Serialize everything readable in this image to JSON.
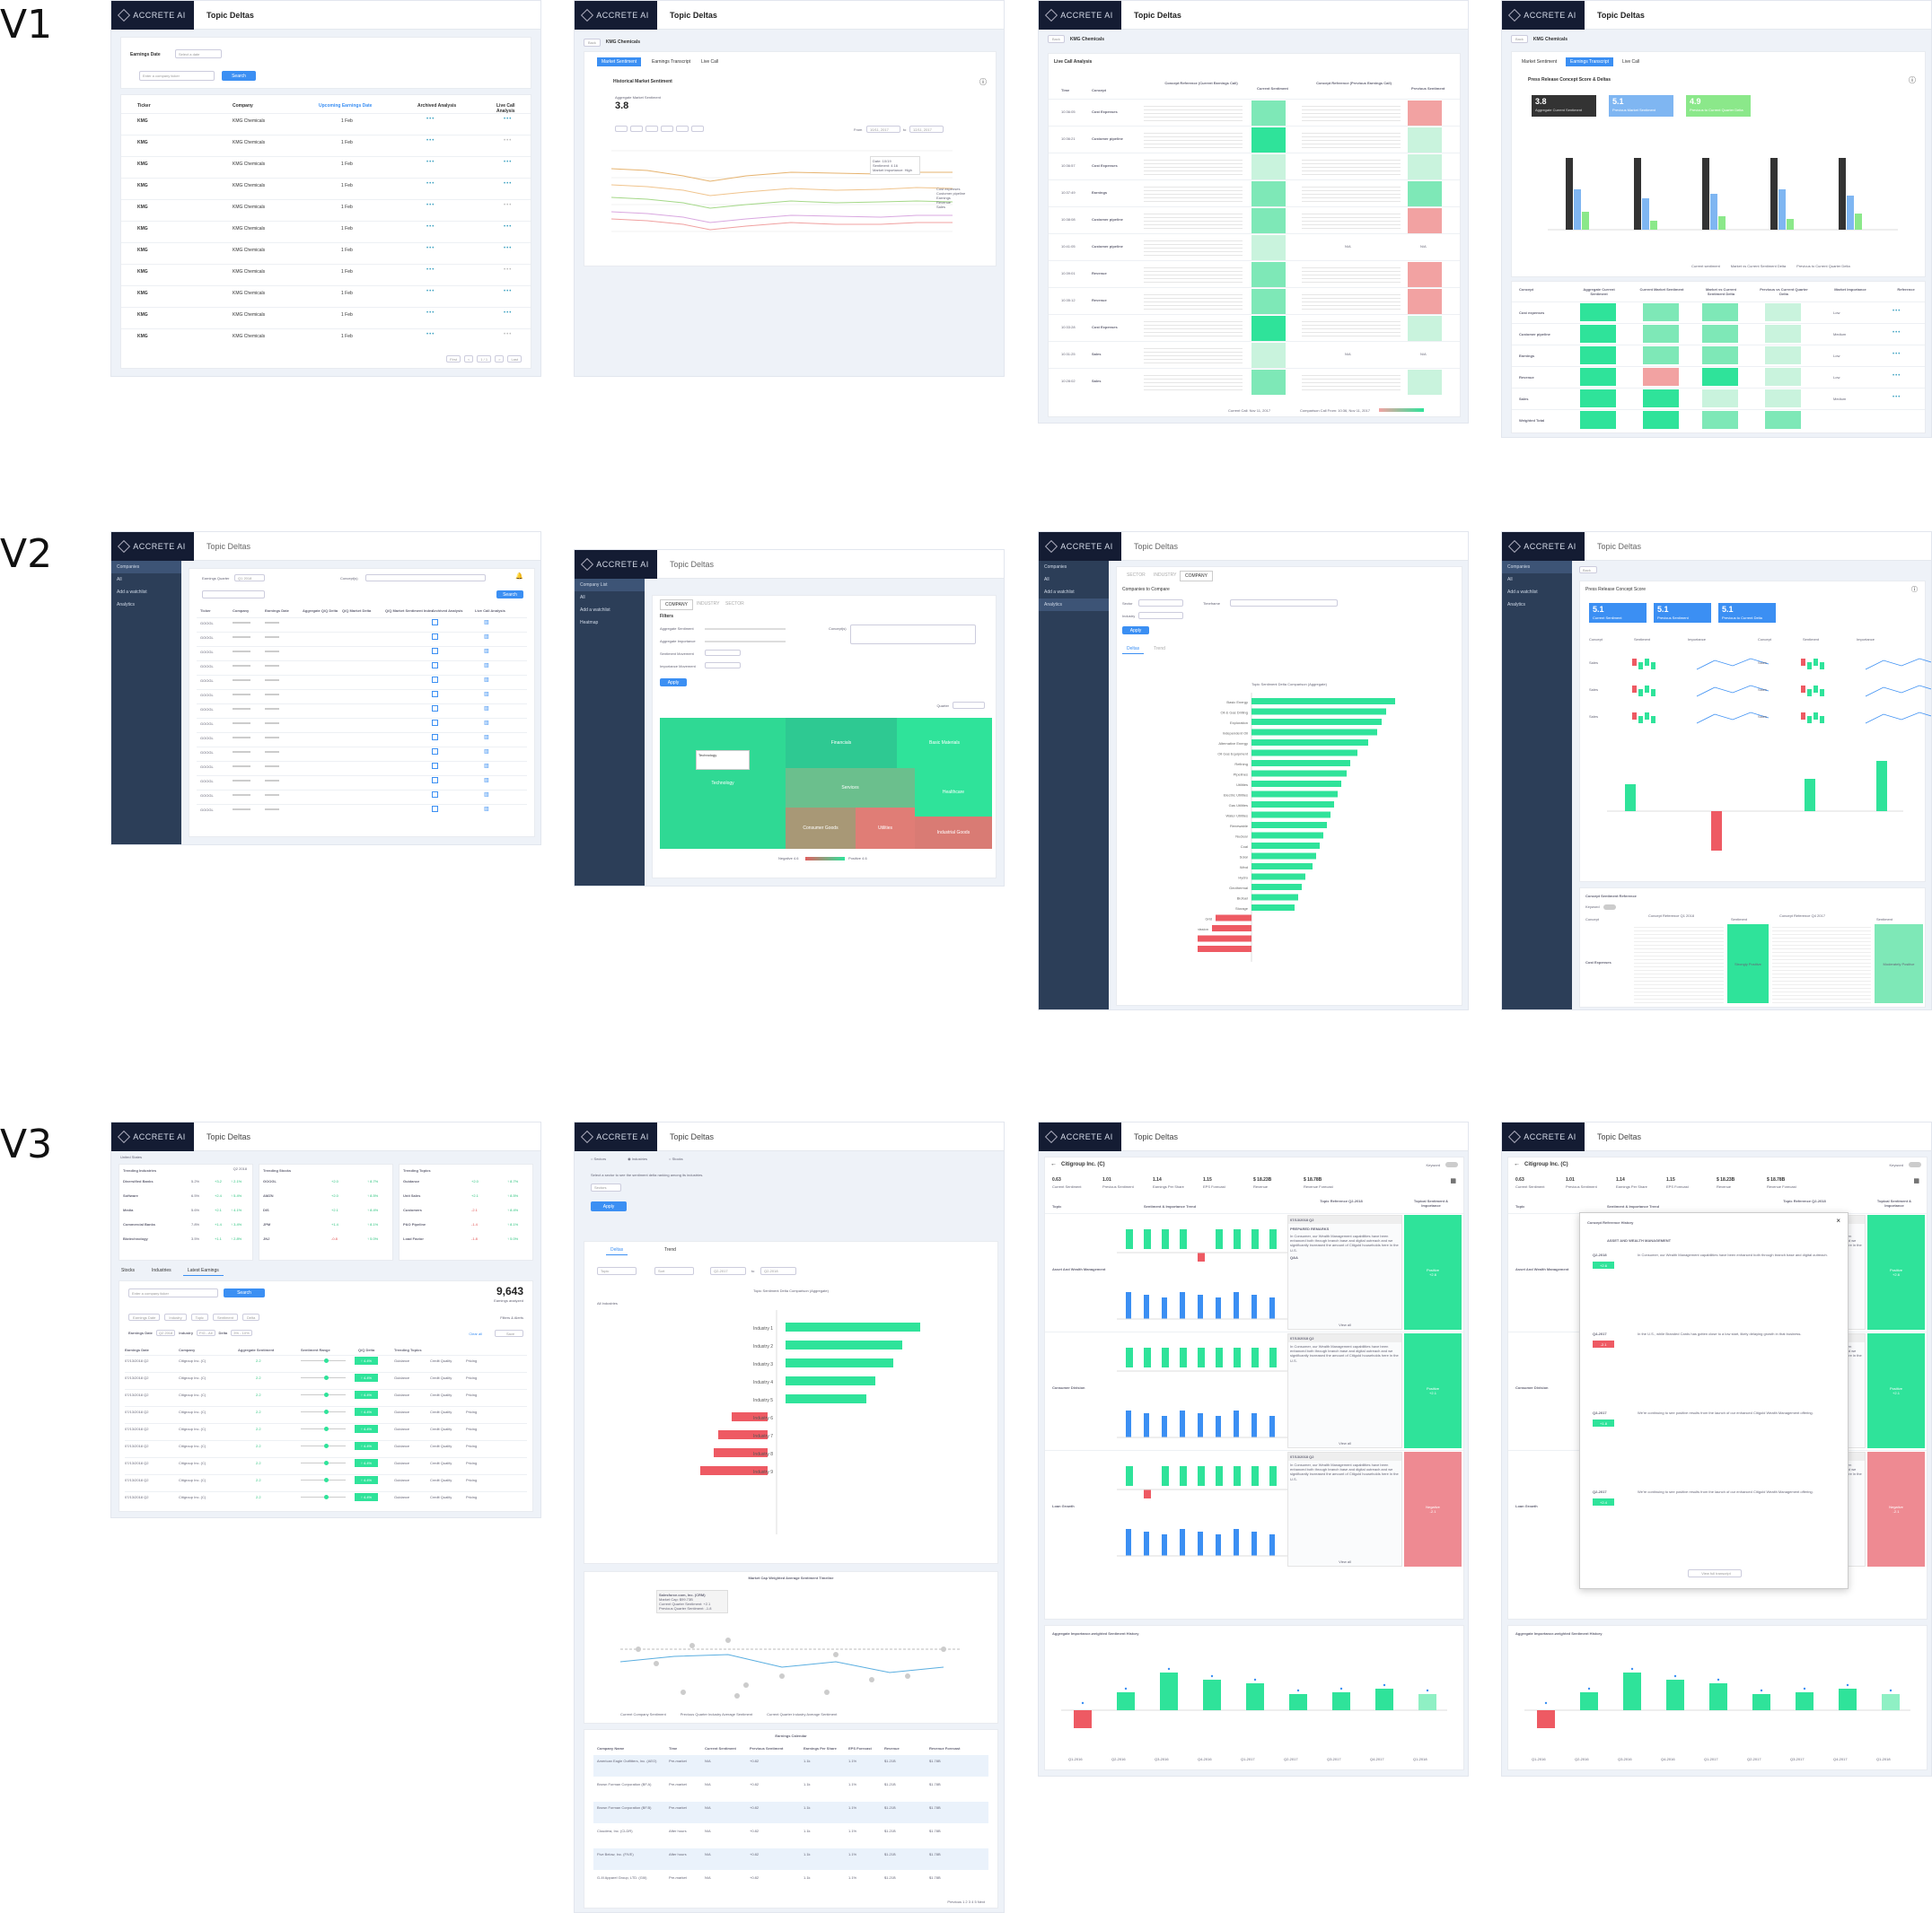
{
  "rows": {
    "v1": "V1",
    "v2": "V2",
    "v3": "V3"
  },
  "app": {
    "logo": "ACCRETE AI",
    "title": "Topic Deltas"
  },
  "v1a": {
    "label": "Earnings Date",
    "select": "Select a date",
    "search_placeholder": "Enter a company ticker",
    "search_btn": "Search",
    "cols": [
      "Ticker",
      "Company",
      "Upcoming Earnings Date",
      "Archived Analysis",
      "Live Call Analysis"
    ],
    "ticker": "KMG",
    "company": "KMG Chemicals",
    "date": "1 Feb",
    "pager": [
      "First",
      "<",
      "1 / 1",
      ">",
      "Last"
    ]
  },
  "v1b": {
    "back": "Back",
    "company": "KMG Chemicals",
    "tabs": [
      "Market Sentiment",
      "Earnings Transcript",
      "Live Call"
    ],
    "chart_title": "Historical Market Sentiment",
    "agg_label": "Aggregate Market Sentiment",
    "agg_value": "3.8",
    "from": "From",
    "to": "to",
    "from_date": "10/11, 2017",
    "to_date": "12/11, 2017",
    "legend": [
      "Cost expenses",
      "Customer pipeline",
      "Earnings",
      "Revenue",
      "Sales"
    ],
    "tooltip": [
      "Date: 10/19",
      "Sentiment: 4.16",
      "Market Importance: High"
    ]
  },
  "v1c": {
    "back": "Back",
    "company": "KMG Chemicals",
    "section": "Live Call Analysis",
    "cols": [
      "Time",
      "Concept",
      "Concept Reference (Current Earnings Call)",
      "Current Sentiment",
      "Concept Reference (Previous Earnings Call)",
      "Previous Sentiment"
    ],
    "rows": [
      [
        "10:36:05",
        "Cost Expenses"
      ],
      [
        "10:36:21",
        "Customer pipeline"
      ],
      [
        "10:36:57",
        "Cost Expenses"
      ],
      [
        "10:37:49",
        "Earnings"
      ],
      [
        "10:38:08",
        "Customer pipeline"
      ],
      [
        "10:41:05",
        "Customer pipeline"
      ],
      [
        "10:39:01",
        "Revenue"
      ],
      [
        "10:35:12",
        "Revenue"
      ],
      [
        "10:33:28",
        "Cost Expenses"
      ],
      [
        "10:31:25",
        "Sales"
      ],
      [
        "10:28:02",
        "Sales"
      ]
    ],
    "na": "N/A",
    "footer": [
      "Current Call: Nov 11, 2017",
      "Comparison Call From: 10:36, Nov 11, 2017"
    ]
  },
  "v1d": {
    "back": "Back",
    "company": "KMG Chemicals",
    "tabs": [
      "Market Sentiment",
      "Earnings Transcript",
      "Live Call"
    ],
    "chart_title": "Press Release Concept Score & Deltas",
    "kpis": [
      {
        "value": "3.8",
        "label": "Aggregate Current Sentiment"
      },
      {
        "value": "5.1",
        "label": "Previous Market Sentiment"
      },
      {
        "value": "4.9",
        "label": "Previous to Current Quarter Delta"
      }
    ],
    "legend": [
      "Current sentiment",
      "Market vs Current Sentiment Delta",
      "Previous to Current Quarter Delta"
    ],
    "cols": [
      "Concept",
      "Aggregate Current Sentiment",
      "Current Market Sentiment",
      "Market vs Current Sentiment Delta",
      "Previous vs Current Quarter Delta",
      "Market Importance",
      "Reference"
    ],
    "rows": [
      [
        "Cost expenses",
        "Low"
      ],
      [
        "Customer pipeline",
        "Medium"
      ],
      [
        "Earnings",
        "Low"
      ],
      [
        "Revenue",
        "Low"
      ],
      [
        "Sales",
        "Medium"
      ],
      [
        "Weighted Total",
        ""
      ]
    ]
  },
  "v2a": {
    "side": [
      "Companies",
      "All",
      "Add a watchlist",
      "Analytics"
    ],
    "quarter_label": "Earnings Quarter",
    "quarter": "Q1 2018",
    "concept_label": "Concept(s)",
    "search_btn": "Search",
    "cols": [
      "Ticker",
      "Company",
      "Earnings Date",
      "Aggregate Q/Q Delta",
      "Q/Q Market Delta",
      "Q/Q Market Sentiment Index",
      "Archived Analysis",
      "Live Call Analysis"
    ],
    "ticker": "GOOGL"
  },
  "v2b": {
    "side": [
      "Company List",
      "All",
      "Add a watchlist",
      "Heatmap"
    ],
    "tabs": [
      "COMPANY",
      "INDUSTRY",
      "SECTOR"
    ],
    "filters_title": "Filters",
    "filters": [
      "Aggregate Sentiment",
      "Aggregate Importance",
      "Sentiment Movement",
      "Importance Movement"
    ],
    "concepts_label": "Concept(s)",
    "apply": "Apply",
    "quarter_label": "Quarter",
    "tiles": [
      "Technology",
      "Financials",
      "Basic Materials",
      "Services",
      "Healthcare",
      "Consumer Goods",
      "Utilities",
      "Industrial Goods"
    ],
    "tooltip": "Technology",
    "neg": "Negative 4.6",
    "pos": "Positive 4.6"
  },
  "v2c": {
    "tabs": [
      "SECTOR",
      "INDUSTRY",
      "COMPANY"
    ],
    "compare_label": "Companies to Compare",
    "sector_label": "Sector",
    "industry_label": "Industry",
    "timeframe_label": "Timeframe",
    "apply": "Apply",
    "subtabs": [
      "Deltas",
      "Trend"
    ],
    "chart_title": "Topic Sentiment Delta Comparison (Aggregate)",
    "bars": [
      "Basic Energy",
      "Oil & Gas Drilling",
      "Exploration",
      "Independent Oil",
      "Alternative Energy",
      "Oil Gas Equipment",
      "Refining",
      "Pipelines",
      "Utilities",
      "Electric Utilities",
      "Gas Utilities",
      "Water Utilities",
      "Renewable",
      "Nuclear",
      "Coal",
      "Solar",
      "Wind",
      "Hydro",
      "Geothermal",
      "Biofuel",
      "Storage",
      "Grid",
      "Transmission",
      "Distribution",
      "Retail Energy"
    ]
  },
  "v2d": {
    "back": "Back",
    "chart_title": "Press Release Concept Score",
    "kpis": [
      {
        "value": "5.1",
        "label": "Current Sentiment"
      },
      {
        "value": "5.1",
        "label": "Previous Sentiment"
      },
      {
        "value": "5.1",
        "label": "Previous to Current Delta"
      }
    ],
    "cols": [
      "Concept",
      "Sentiment",
      "Importance"
    ],
    "concepts": [
      "Sales",
      "Sales",
      "Sales"
    ],
    "ref_title": "Concept Sentiment Reference",
    "keyword": "Keyword",
    "ref_cols": [
      "Concept",
      "Concept Reference Q1 2018",
      "Sentiment",
      "Concept Reference Q4 2017",
      "Sentiment"
    ],
    "sent_pos": "Strongly Positive",
    "sent_mod": "Moderately Positive",
    "cost_label": "Cost Expenses"
  },
  "v3a": {
    "country": "United States",
    "quarter": "Q2 2018",
    "industries_title": "Trending Industries",
    "industries": [
      [
        "Diversified Banks",
        "5.2%",
        "+3.2",
        "↑ 2.1%"
      ],
      [
        "Software",
        "6.5%",
        "+2.4",
        "↑ 5.4%"
      ],
      [
        "Media",
        "5.6%",
        "+2.1",
        "↑ 4.1%"
      ],
      [
        "Commercial Banks",
        "7.8%",
        "+1.4",
        "↑ 3.4%"
      ],
      [
        "Biotechnology",
        "3.5%",
        "+1.1",
        "↑ 2.8%"
      ]
    ],
    "stocks_title": "Trending Stocks",
    "stocks": [
      [
        "GOOGL",
        "+2.0",
        "↑ 8.7%"
      ],
      [
        "AMZN",
        "+2.0",
        "↑ 8.5%"
      ],
      [
        "DIS",
        "+2.1",
        "↑ 8.4%"
      ],
      [
        "JPM",
        "+1.4",
        "↑ 8.1%"
      ],
      [
        "JNJ",
        "-0.8",
        "↑ 5.0%"
      ]
    ],
    "topics_title": "Trending Topics",
    "topics": [
      [
        "Guidance",
        "+2.0",
        "↑ 8.7%"
      ],
      [
        "Unit Sales",
        "+2.1",
        "↑ 8.5%"
      ],
      [
        "Customers",
        "-2.1",
        "↑ 8.4%"
      ],
      [
        "P&O Pipeline",
        "-1.4",
        "↑ 8.1%"
      ],
      [
        "Load Factor",
        "-1.8",
        "↑ 5.0%"
      ]
    ],
    "tabs": [
      "Stocks",
      "Industries",
      "Latest Earnings"
    ],
    "search_placeholder": "Enter a company ticker",
    "search_btn": "Search",
    "count": "9,643",
    "count_label": "Earnings analyzed",
    "filters": [
      "Earnings Date",
      "Industry",
      "Topic",
      "Sentiment",
      "Delta"
    ],
    "filters_alerts": "Filters & Alerts",
    "chips": [
      "Earnings Date",
      "Q2 2018",
      "Industry",
      "FIG - All",
      "Delta",
      "3% - 10%"
    ],
    "clear": "Clear all",
    "save": "Save",
    "cols": [
      "Earnings Date",
      "Company",
      "Aggregate Sentiment",
      "Sentiment Range",
      "Q/Q Delta",
      "Trending Topics"
    ],
    "row": {
      "date": "07/13/2018 Q2",
      "company": "Citigroup Inc. (C)",
      "sent": "2.2",
      "delta": "↑ 4.4%",
      "t1": "Guidance",
      "t2": "Credit Quality",
      "t3": "Pricing"
    }
  },
  "v3b": {
    "radios": [
      "Sectors",
      "Industries",
      "Stocks"
    ],
    "instruction": "Select a sector to see the sentiment delta ranking among its industries.",
    "sector": "Sectors",
    "apply": "Apply",
    "tabs": [
      "Deltas",
      "Trend"
    ],
    "selects": [
      "Topic",
      "Sort",
      "Q2-2017",
      "to",
      "Q2-2018"
    ],
    "chart_title": "Topic Sentiment Delta Comparison (Aggregate)",
    "all_ind": "All Industries",
    "industries": [
      "Industry 1",
      "Industry 2",
      "Industry 3",
      "Industry 4",
      "Industry 5",
      "Industry 6",
      "Industry 7",
      "Industry 8",
      "Industry 9"
    ],
    "timeline_title": "Market Cap Weighted Average Sentiment Timeline",
    "tip": [
      "Salesforce.com, Inc. (CRM)",
      "Market Cap: $99.73B",
      "Current Quarter Sentiment: +2.1",
      "Previous Quarter Sentiment: -1.8"
    ],
    "tl_legend": [
      "Current Company Sentiment",
      "Previous Quarter Industry Average Sentiment",
      "Current Quarter Industry Average Sentiment"
    ],
    "cal_title": "Earnings Calendar",
    "cal_cols": [
      "Company Name",
      "Time",
      "Current Sentiment",
      "Previous Sentiment",
      "Earnings Per Share",
      "EPS Forecast",
      "Revenue",
      "Revenue Forecast"
    ],
    "cal": [
      [
        "American Eagle Outfitters, Inc. (AEO)",
        "Pre-market"
      ],
      [
        "Brown Forman Corporation (BF.A)",
        "Pre-market"
      ],
      [
        "Brown Forman Corporation (BF.B)",
        "Pre-market"
      ],
      [
        "Cloudera, Inc. (CLDR)",
        "After hours"
      ],
      [
        "Five Below, Inc. (FIVE)",
        "After hours"
      ],
      [
        "G-III Apparel Group, LTD. (GIII)",
        "Pre-market"
      ]
    ],
    "cal_vals": [
      "N/A",
      "+0.82",
      "1.1k",
      "1.1%",
      "$1.21B",
      "$1.78B"
    ],
    "pager": "Previous 1 2 3 4 5 Next"
  },
  "v3c": {
    "company": "Citigroup Inc. (C)",
    "keyword": "Keyword",
    "metrics": [
      [
        "0.63",
        "Current Sentiment"
      ],
      [
        "1.01",
        "Previous Sentiment"
      ],
      [
        "1.14",
        "Earnings Per Share"
      ],
      [
        "1.15",
        "EPS Forecast"
      ],
      [
        "$ 18.23B",
        "Revenue"
      ],
      [
        "$ 18.78B",
        "Revenue Forecast"
      ]
    ],
    "topic": "Topic",
    "trend_label": "Sentiment & Importance Trend",
    "ref_label": "Topic Reference Q2-2018",
    "topical_label": "Topical Sentiment & Importance",
    "topics": [
      "Asset And Wealth Management",
      "Consumer Division",
      "Loan Growth"
    ],
    "ref_date": "07/13/2018 Q2",
    "ref_head": "PREPARED REMARKS",
    "qa": "Q&A",
    "view_all": "View all",
    "ref_text": "In Consumer, our Wealth Management capabilities have been enhanced both through branch base and digital outreach and we significantly increased the amount of Citigold households here in the U.S.",
    "badges": [
      [
        "Positive",
        "+2.6"
      ],
      [
        "Positive",
        "+2.1"
      ],
      [
        "Negative",
        "-2.1"
      ]
    ],
    "hist_title": "Aggregate Importance-weighted Sentiment History",
    "quarters": [
      "Q1-2016",
      "Q2-2016",
      "Q3-2016",
      "Q4-2016",
      "Q1-2017",
      "Q2-2017",
      "Q3-2017",
      "Q4-2017",
      "Q1-2018"
    ]
  },
  "v3d": {
    "modal_title": "Concept Reference History",
    "modal_section": "ASSET AND WEALTH MANAGEMENT",
    "entries": [
      [
        "Q2-2018",
        "+2.6"
      ],
      [
        "Q4-2017",
        "-2.1"
      ],
      [
        "Q3-2017",
        "+1.8"
      ],
      [
        "Q2-2017",
        "+2.4"
      ]
    ],
    "texts": [
      "In Consumer, our Wealth Management capabilities have been enhanced both through branch base and digital outreach.",
      "In the U.S., while Branded Cards has gotten close to a low start, likely delaying growth in that business.",
      "We're continuing to see positive results from the launch of our enhanced Citigold Wealth Management offering.",
      "We're continuing to see positive results from the launch of our enhanced Citigold Wealth Management offering."
    ],
    "view_transcript": "View full transcript",
    "close": "×"
  }
}
